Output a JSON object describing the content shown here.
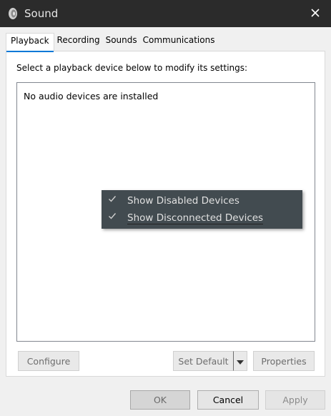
{
  "window": {
    "title": "Sound",
    "title_icon": "speaker-icon",
    "close_icon": "close-icon"
  },
  "tabs": [
    {
      "label": "Playback",
      "active": true
    },
    {
      "label": "Recording",
      "active": false
    },
    {
      "label": "Sounds",
      "active": false
    },
    {
      "label": "Communications",
      "active": false
    }
  ],
  "playback": {
    "instruction": "Select a playback device below to modify its settings:",
    "empty_message": "No audio devices are installed"
  },
  "context_menu": {
    "items": [
      {
        "label": "Show Disabled Devices",
        "checked": true,
        "icon": "check-icon"
      },
      {
        "label": "Show Disconnected Devices",
        "checked": true,
        "icon": "check-icon"
      }
    ]
  },
  "panel_buttons": {
    "configure": "Configure",
    "set_default": "Set Default",
    "set_default_dropdown_icon": "dropdown-arrow-icon",
    "properties": "Properties"
  },
  "dialog_buttons": {
    "ok": "OK",
    "cancel": "Cancel",
    "apply": "Apply"
  },
  "colors": {
    "titlebar": "#2b2b2b",
    "menu_background": "#424b50",
    "tab_accent": "#0078d7"
  }
}
